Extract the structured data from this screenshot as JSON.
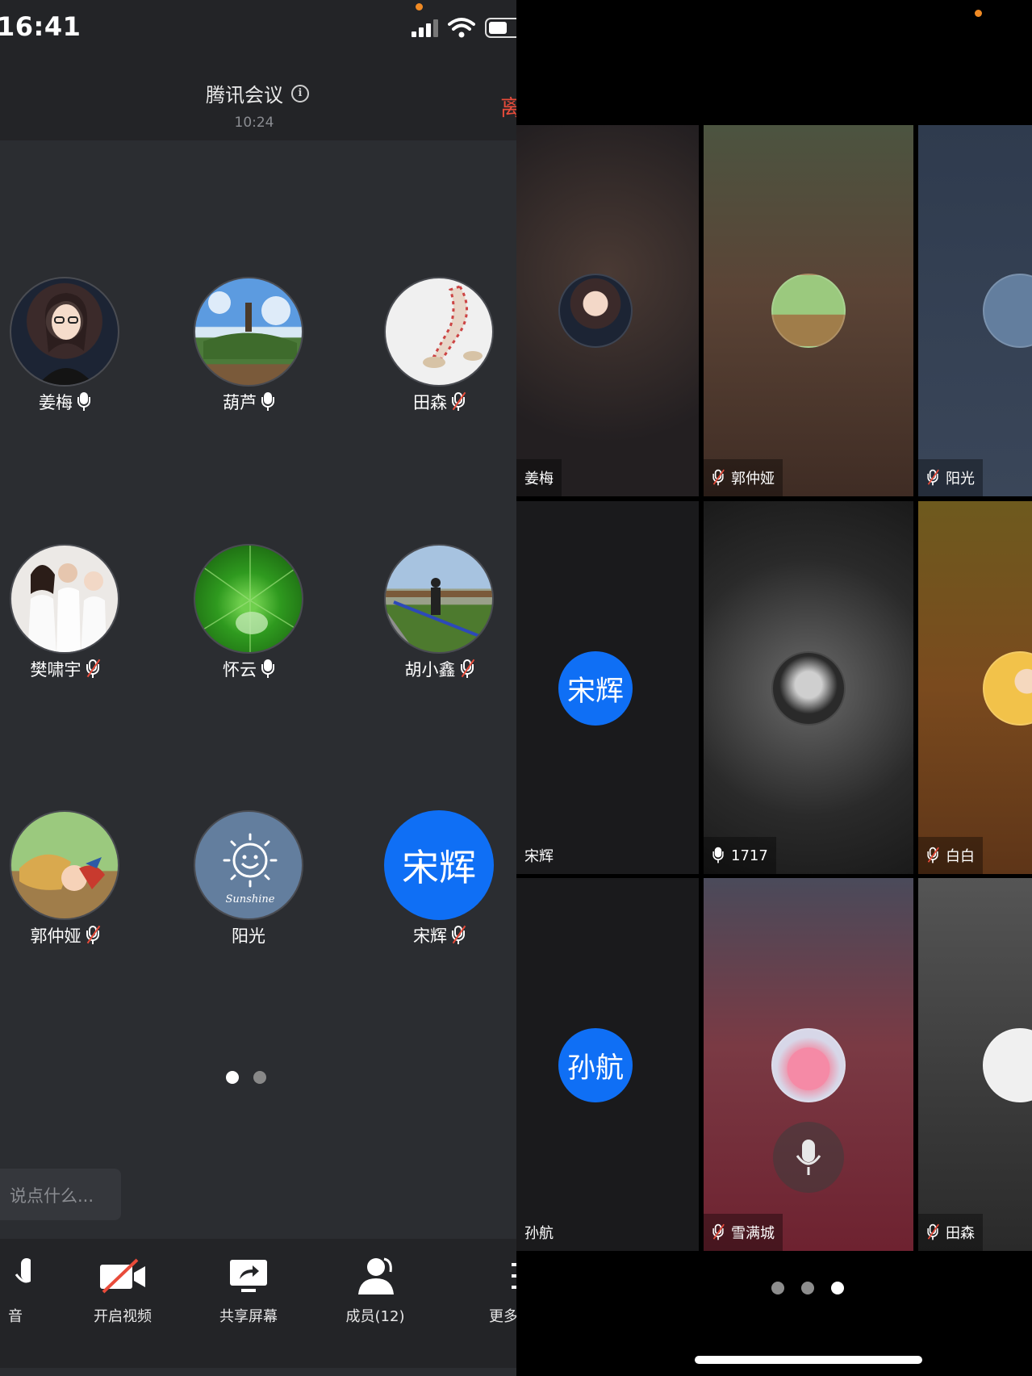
{
  "status_bar": {
    "time": "16:41"
  },
  "header": {
    "title": "腾讯会议",
    "time": "10:24",
    "leave_label": "离"
  },
  "participants_grid": [
    {
      "name": "姜梅",
      "mic": "on"
    },
    {
      "name": "葫芦",
      "mic": "on"
    },
    {
      "name": "田森",
      "mic": "muted"
    },
    {
      "name": "樊啸宇",
      "mic": "muted"
    },
    {
      "name": "怀云",
      "mic": "on"
    },
    {
      "name": "胡小鑫",
      "mic": "muted"
    },
    {
      "name": "郭仲娅",
      "mic": "muted"
    },
    {
      "name": "阳光",
      "mic": "none"
    },
    {
      "name": "宋辉",
      "mic": "muted",
      "avatar_text": "宋辉"
    }
  ],
  "left_pagination": {
    "total": 2,
    "active": 1
  },
  "chat": {
    "placeholder": "说点什么..."
  },
  "toolbar": {
    "mic_label": "音",
    "video_label": "开启视频",
    "share_label": "共享屏幕",
    "members_label": "成员(12)",
    "more_label": "更多"
  },
  "video_grid": [
    {
      "name": "姜梅",
      "mic": "none"
    },
    {
      "name": "郭仲娅",
      "mic": "muted"
    },
    {
      "name": "阳光",
      "mic": "muted"
    },
    {
      "name": "宋辉",
      "mic": "none",
      "avatar_text": "宋辉"
    },
    {
      "name": "1717",
      "mic": "on"
    },
    {
      "name": "白白",
      "mic": "muted"
    },
    {
      "name": "孙航",
      "mic": "none",
      "avatar_text": "孙航"
    },
    {
      "name": "雪满城",
      "mic": "muted"
    },
    {
      "name": "田森",
      "mic": "muted"
    }
  ],
  "right_pagination": {
    "total": 3,
    "active": 3
  },
  "colors": {
    "accent_blue": "#0f6ff5",
    "leave_red": "#e84b3a",
    "status_orange": "#f08a24"
  },
  "icons": [
    "info-icon",
    "microphone-icon",
    "microphone-muted-icon",
    "video-off-icon",
    "share-screen-icon",
    "members-icon",
    "more-menu-icon"
  ]
}
